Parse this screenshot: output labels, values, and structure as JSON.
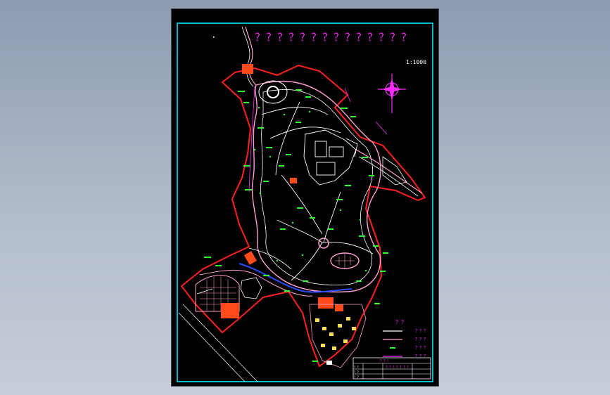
{
  "drawing": {
    "title_glyphs": "？？？？？？？？？？？？？？",
    "scale": "1:1000",
    "colors": {
      "frame": "#00e5ff",
      "boundary": "#ff2020",
      "road": "#ff9fd0",
      "path_white": "#ffffff",
      "tree": "#2fff2f",
      "building": "#ff4a1a",
      "magenta": "#ff2bff",
      "blue_road": "#2b4bff"
    }
  },
  "compass": {
    "icon": "north-arrow-icon"
  },
  "legend": {
    "title": "？？",
    "rows": [
      {
        "sample": "line-white",
        "label": "？？？"
      },
      {
        "sample": "line-pink",
        "label": "？？？"
      },
      {
        "sample": "tree-mark",
        "label": "？？？"
      },
      {
        "sample": "line-magenta",
        "label": "？？？"
      }
    ]
  },
  "title_block": {
    "header": "？？？",
    "project": "？？？？？？？",
    "rows": [
      "？？",
      "？？",
      "？？"
    ]
  }
}
